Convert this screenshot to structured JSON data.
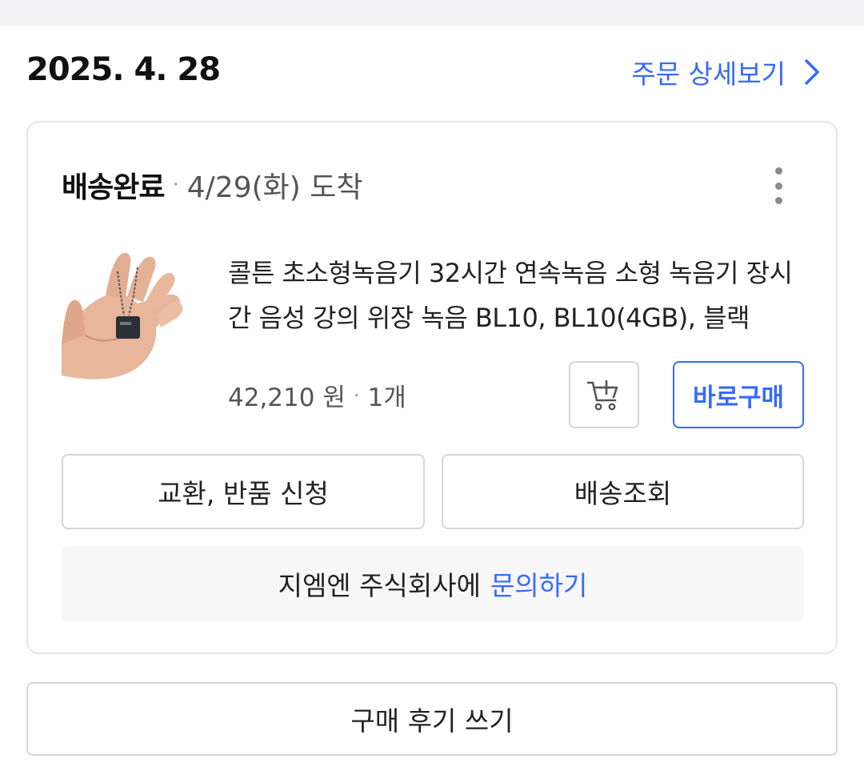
{
  "order": {
    "date": "2025. 4. 28",
    "detail_link": "주문 상세보기"
  },
  "shipment": {
    "status": "배송완료",
    "separator": "·",
    "arrival": "4/29(화) 도착"
  },
  "product": {
    "name": "콜튼 초소형녹음기 32시간 연속녹음 소형 녹음기 장시간 음성 강의 위장 녹음 BL10, BL10(4GB), 블랙",
    "price": "42,210 원",
    "quantity": "1개",
    "image": "hand-holding-mini-voice-recorder"
  },
  "buttons": {
    "buy_now": "바로구매",
    "exchange_return": "교환, 반품 신청",
    "track_delivery": "배송조회",
    "write_review": "구매 후기 쓰기"
  },
  "inquiry": {
    "seller_text": "지엠엔 주식회사에",
    "link": "문의하기"
  },
  "colors": {
    "accent": "#346aff",
    "border": "#d6d6d8",
    "inquiry_bg": "#f7f7f8",
    "topbar_bg": "#f2f2f4"
  },
  "icons": [
    "chevron-right-icon",
    "more-vertical-icon",
    "add-to-cart-icon"
  ]
}
